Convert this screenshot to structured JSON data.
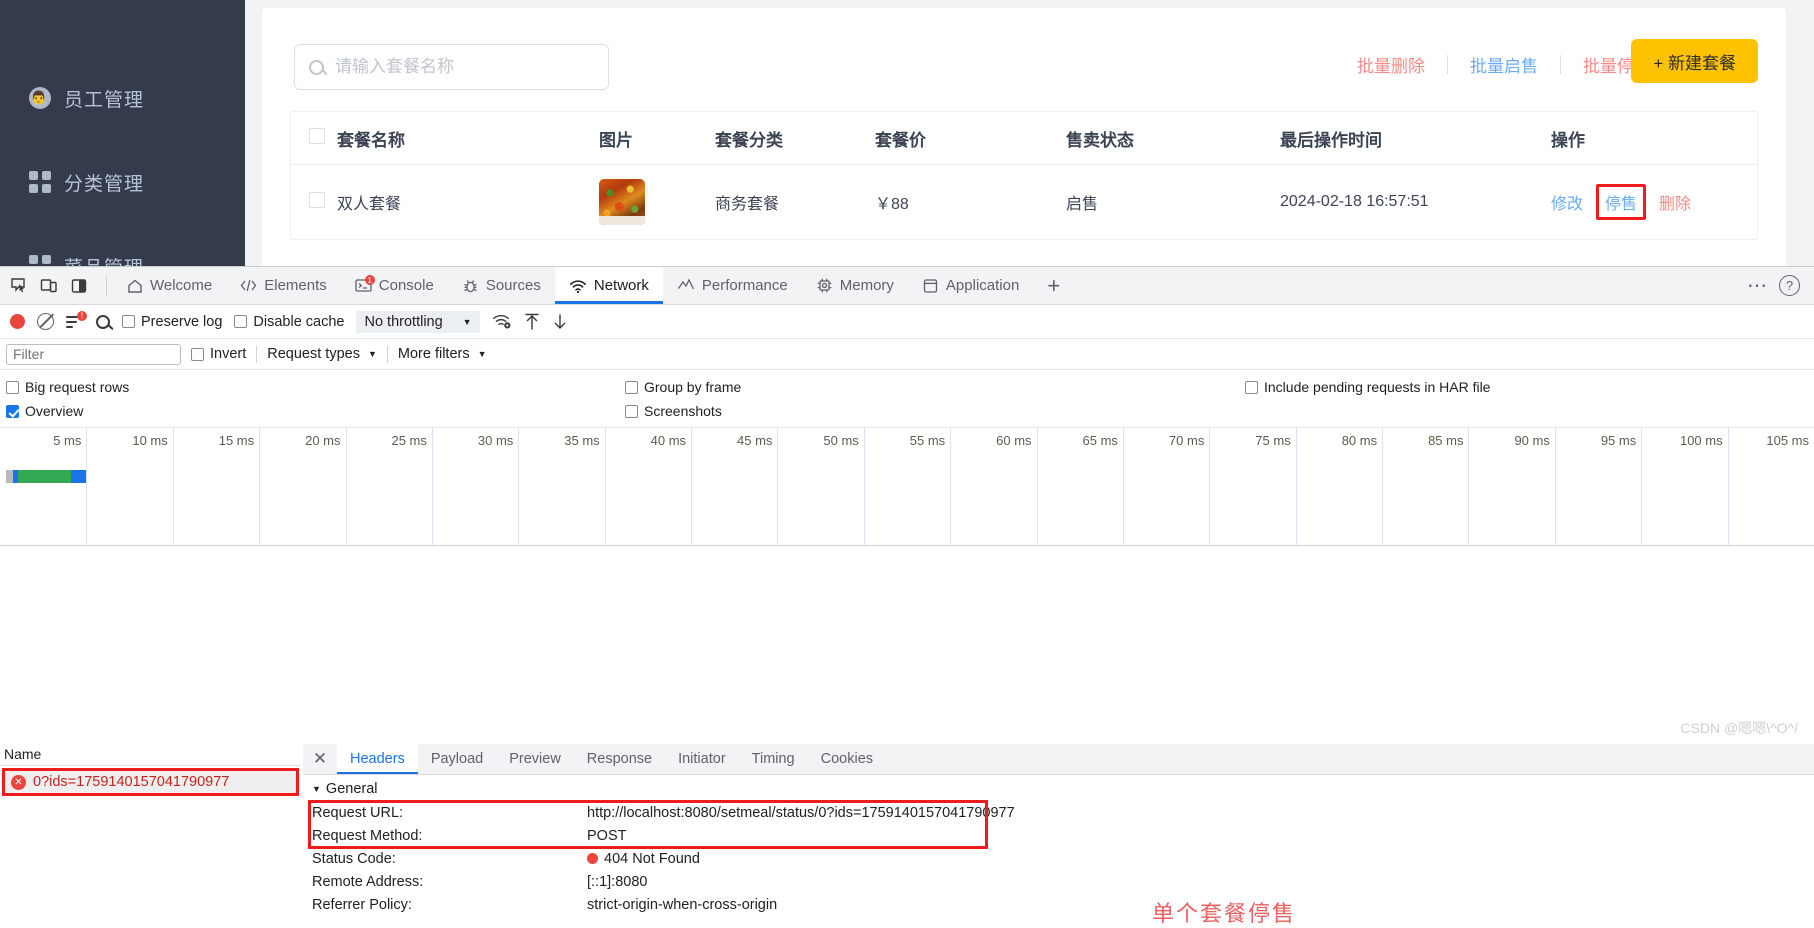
{
  "app": {
    "sidebar": {
      "items": [
        {
          "label": "员工管理",
          "icon": "employee-icon"
        },
        {
          "label": "分类管理",
          "icon": "category-icon"
        },
        {
          "label": "菜品管理",
          "icon": "dish-icon"
        }
      ]
    },
    "search": {
      "placeholder": "请输入套餐名称",
      "value": "",
      "icon": "search-icon"
    },
    "batch_actions": [
      {
        "label": "批量删除",
        "style": "danger"
      },
      {
        "label": "批量启售",
        "style": "primary"
      },
      {
        "label": "批量停售",
        "style": "danger"
      }
    ],
    "new_button": {
      "label": "+ 新建套餐",
      "color": "#ffc200"
    },
    "table": {
      "columns": [
        "套餐名称",
        "图片",
        "套餐分类",
        "套餐价",
        "售卖状态",
        "最后操作时间",
        "操作"
      ],
      "rows": [
        {
          "name": "双人套餐",
          "image": "setmeal-thumbnail",
          "category": "商务套餐",
          "price": "￥88",
          "status": "启售",
          "time": "2024-02-18 16:57:51",
          "ops": [
            {
              "label": "修改",
              "style": "primary",
              "highlighted": false
            },
            {
              "label": "停售",
              "style": "primary",
              "highlighted": true
            },
            {
              "label": "删除",
              "style": "danger",
              "highlighted": false
            }
          ]
        }
      ]
    }
  },
  "devtools": {
    "panel_tabs": [
      {
        "label": "Welcome",
        "icon": "home-icon",
        "active": false
      },
      {
        "label": "Elements",
        "icon": "code-icon",
        "active": false
      },
      {
        "label": "Console",
        "icon": "console-icon",
        "active": false
      },
      {
        "label": "Sources",
        "icon": "bug-icon",
        "active": false
      },
      {
        "label": "Network",
        "icon": "network-icon",
        "active": true
      },
      {
        "label": "Performance",
        "icon": "performance-icon",
        "active": false
      },
      {
        "label": "Memory",
        "icon": "memory-icon",
        "active": false
      },
      {
        "label": "Application",
        "icon": "application-icon",
        "active": false
      }
    ],
    "add_tab_label": "+",
    "more_label": "⋯",
    "help_label": "?",
    "toolbar": {
      "record_icon": "record-icon",
      "clear_icon": "clear-icon",
      "filter_icon": "filter-icon",
      "search_icon": "search-icon",
      "preserve_log": {
        "label": "Preserve log",
        "checked": false
      },
      "disable_cache": {
        "label": "Disable cache",
        "checked": false
      },
      "throttling": {
        "value": "No throttling"
      },
      "wifi_icon": "network-conditions-icon",
      "import_icon": "import-har-icon",
      "export_icon": "export-har-icon"
    },
    "filterbar": {
      "filter_placeholder": "Filter",
      "filter_value": "",
      "invert": {
        "label": "Invert",
        "checked": false
      },
      "request_types": "Request types",
      "more_filters": "More filters"
    },
    "options": {
      "big_request_rows": {
        "label": "Big request rows",
        "checked": false
      },
      "overview": {
        "label": "Overview",
        "checked": true
      },
      "group_by_frame": {
        "label": "Group by frame",
        "checked": false
      },
      "screenshots": {
        "label": "Screenshots",
        "checked": false
      },
      "include_pending": {
        "label": "Include pending requests in HAR file",
        "checked": false
      }
    },
    "timeline": {
      "ticks": [
        "5 ms",
        "10 ms",
        "15 ms",
        "20 ms",
        "25 ms",
        "30 ms",
        "35 ms",
        "40 ms",
        "45 ms",
        "50 ms",
        "55 ms",
        "60 ms",
        "65 ms",
        "70 ms",
        "75 ms",
        "80 ms",
        "85 ms",
        "90 ms",
        "95 ms",
        "100 ms",
        "105 ms"
      ]
    },
    "requests": {
      "column_header": "Name",
      "rows": [
        {
          "name": "0?ids=1759140157041790977",
          "status": "error",
          "highlighted": true
        }
      ]
    },
    "details": {
      "close_icon": "close-icon",
      "tabs": [
        {
          "label": "Headers",
          "active": true
        },
        {
          "label": "Payload",
          "active": false
        },
        {
          "label": "Preview",
          "active": false
        },
        {
          "label": "Response",
          "active": false
        },
        {
          "label": "Initiator",
          "active": false
        },
        {
          "label": "Timing",
          "active": false
        },
        {
          "label": "Cookies",
          "active": false
        }
      ],
      "general_label": "General",
      "general": [
        {
          "key": "Request URL:",
          "value": "http://localhost:8080/setmeal/status/0?ids=1759140157041790977",
          "highlighted": true
        },
        {
          "key": "Request Method:",
          "value": "POST",
          "highlighted": true
        },
        {
          "key": "Status Code:",
          "value": "404 Not Found",
          "dot": "#e8453c",
          "highlighted": false
        },
        {
          "key": "Remote Address:",
          "value": "[::1]:8080",
          "highlighted": false
        },
        {
          "key": "Referrer Policy:",
          "value": "strict-origin-when-cross-origin",
          "highlighted": false
        }
      ]
    }
  },
  "annotation": "单个套餐停售",
  "watermark": "CSDN @嗯嗯\\^O^/"
}
